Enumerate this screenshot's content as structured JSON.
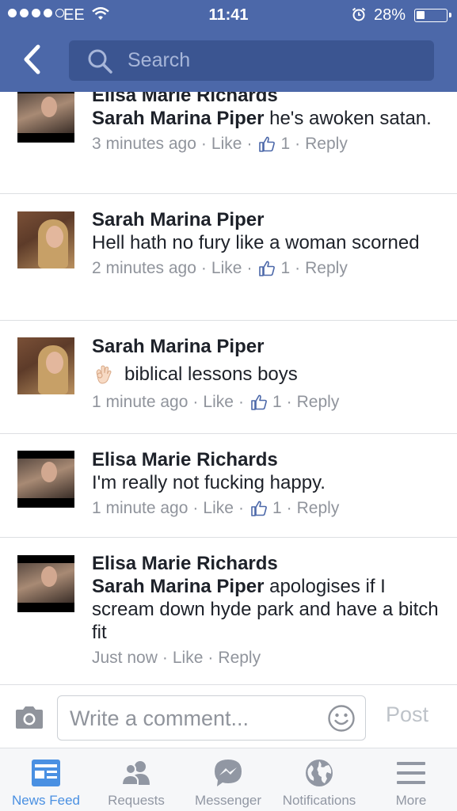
{
  "status_bar": {
    "carrier": "EE",
    "time": "11:41",
    "battery": "28%"
  },
  "header": {
    "search_placeholder": "Search"
  },
  "comments": [
    {
      "author": "Elisa Marie Richards",
      "mention": "Sarah Marina Piper",
      "text": " he's awoken satan.",
      "time": "3 minutes ago",
      "like_label": "Like",
      "like_count": "1",
      "reply_label": "Reply",
      "avatar": "elisa"
    },
    {
      "author": "Sarah Marina Piper",
      "text": "Hell hath no fury like a woman scorned",
      "time": "2 minutes ago",
      "like_label": "Like",
      "like_count": "1",
      "reply_label": "Reply",
      "avatar": "sarah"
    },
    {
      "author": "Sarah Marina Piper",
      "emoji": "ok-hand-emoji",
      "text": "biblical lessons boys",
      "time": "1 minute ago",
      "like_label": "Like",
      "like_count": "1",
      "reply_label": "Reply",
      "avatar": "sarah"
    },
    {
      "author": "Elisa Marie Richards",
      "text": "I'm really not fucking happy.",
      "time": "1 minute ago",
      "like_label": "Like",
      "like_count": "1",
      "reply_label": "Reply",
      "avatar": "elisa"
    },
    {
      "author": "Elisa Marie Richards",
      "mention": "Sarah Marina Piper",
      "text": " apologises if I scream down hyde park and have a bitch fit",
      "time": "Just now",
      "like_label": "Like",
      "reply_label": "Reply",
      "avatar": "elisa"
    }
  ],
  "composer": {
    "placeholder": "Write a comment...",
    "post_label": "Post"
  },
  "tabbar": {
    "items": [
      {
        "label": "News Feed",
        "icon": "news-feed-icon",
        "active": true
      },
      {
        "label": "Requests",
        "icon": "friend-requests-icon"
      },
      {
        "label": "Messenger",
        "icon": "messenger-icon"
      },
      {
        "label": "Notifications",
        "icon": "globe-icon"
      },
      {
        "label": "More",
        "icon": "menu-icon"
      }
    ]
  },
  "colors": {
    "header_bg": "#4c68a9",
    "search_bg": "#3b5591",
    "active_tab": "#4a90e2",
    "meta_text": "#90949c"
  }
}
